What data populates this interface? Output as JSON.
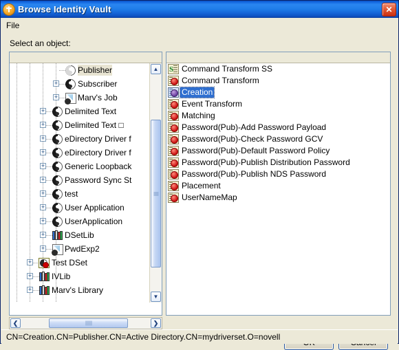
{
  "window": {
    "title": "Browse Identity Vault",
    "app_icon": "identity-vault-icon",
    "close_label": "✕"
  },
  "menubar": {
    "items": [
      {
        "label": "File"
      }
    ]
  },
  "main": {
    "select_label": "Select an object:"
  },
  "tree": {
    "scroll": {
      "up_arrow": "▲",
      "down_arrow": "▼",
      "left_arrow": "❮",
      "right_arrow": "❯"
    },
    "items": [
      {
        "label": "Publisher",
        "depth": 4,
        "icon": "driver-publisher-icon",
        "expander": "",
        "selected": true,
        "last": false
      },
      {
        "label": "Subscriber",
        "depth": 4,
        "icon": "driver-subscriber-icon",
        "expander": "+",
        "selected": false,
        "last": false
      },
      {
        "label": "Marv's Job",
        "depth": 4,
        "icon": "job-icon",
        "expander": "+",
        "selected": false,
        "last": true
      },
      {
        "label": "Delimited Text",
        "depth": 3,
        "icon": "driver-icon",
        "expander": "+",
        "selected": false,
        "last": false
      },
      {
        "label": "Delimited Text □",
        "depth": 3,
        "icon": "driver-icon",
        "expander": "+",
        "selected": false,
        "last": false
      },
      {
        "label": "eDirectory Driver f",
        "depth": 3,
        "icon": "driver-icon",
        "expander": "+",
        "selected": false,
        "last": false
      },
      {
        "label": "eDirectory Driver f",
        "depth": 3,
        "icon": "driver-icon",
        "expander": "+",
        "selected": false,
        "last": false
      },
      {
        "label": "Generic Loopback",
        "depth": 3,
        "icon": "driver-icon",
        "expander": "+",
        "selected": false,
        "last": false
      },
      {
        "label": "Password Sync St",
        "depth": 3,
        "icon": "driver-icon",
        "expander": "+",
        "selected": false,
        "last": false
      },
      {
        "label": "test",
        "depth": 3,
        "icon": "driver-icon",
        "expander": "+",
        "selected": false,
        "last": false
      },
      {
        "label": "User Application",
        "depth": 3,
        "icon": "driver-icon",
        "expander": "+",
        "selected": false,
        "last": false
      },
      {
        "label": "UserApplication",
        "depth": 3,
        "icon": "driver-icon",
        "expander": "+",
        "selected": false,
        "last": false
      },
      {
        "label": "DSetLib",
        "depth": 3,
        "icon": "library-icon",
        "expander": "+",
        "selected": false,
        "last": false
      },
      {
        "label": "PwdExp2",
        "depth": 3,
        "icon": "job-icon",
        "expander": "+",
        "selected": false,
        "last": true
      },
      {
        "label": "Test DSet",
        "depth": 2,
        "icon": "dset-icon",
        "expander": "+",
        "selected": false,
        "last": false
      },
      {
        "label": "IVLib",
        "depth": 2,
        "icon": "library-icon",
        "expander": "+",
        "selected": false,
        "last": false
      },
      {
        "label": "Marv's Library",
        "depth": 2,
        "icon": "library-icon",
        "expander": "+",
        "selected": false,
        "last": false
      }
    ]
  },
  "list": {
    "items": [
      {
        "label": "Command Transform SS",
        "icon": "stylesheet-icon",
        "selected": false
      },
      {
        "label": "Command Transform",
        "icon": "policy-icon",
        "selected": false
      },
      {
        "label": "Creation",
        "icon": "policy-icon",
        "selected": true
      },
      {
        "label": "Event Transform",
        "icon": "policy-icon",
        "selected": false
      },
      {
        "label": "Matching",
        "icon": "policy-icon",
        "selected": false
      },
      {
        "label": "Password(Pub)-Add Password Payload",
        "icon": "policy-icon",
        "selected": false
      },
      {
        "label": "Password(Pub)-Check Password GCV",
        "icon": "policy-icon",
        "selected": false
      },
      {
        "label": "Password(Pub)-Default Password Policy",
        "icon": "policy-icon",
        "selected": false
      },
      {
        "label": "Password(Pub)-Publish Distribution Password",
        "icon": "policy-icon",
        "selected": false
      },
      {
        "label": "Password(Pub)-Publish NDS Password",
        "icon": "policy-icon",
        "selected": false
      },
      {
        "label": "Placement",
        "icon": "policy-icon",
        "selected": false
      },
      {
        "label": "UserNameMap",
        "icon": "policy-icon",
        "selected": false
      }
    ]
  },
  "buttons": {
    "ok": "OK",
    "cancel": "Cancel"
  },
  "statusbar": {
    "text": "CN=Creation.CN=Publisher.CN=Active Directory.CN=mydriverset.O=novell"
  },
  "colors": {
    "titlebar": "#1f7de9",
    "selection": "#2f6fd0",
    "dialog_face": "#ece9d8",
    "border": "#0a246a"
  }
}
